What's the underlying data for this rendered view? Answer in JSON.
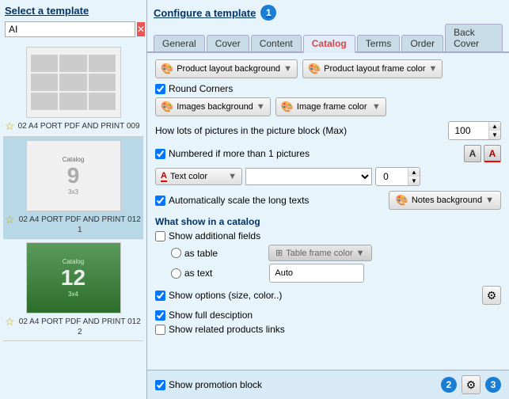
{
  "left_panel": {
    "title": "Select a template",
    "search_placeholder": "AI",
    "templates": [
      {
        "id": "template-1",
        "label": "02 A4 PORT PDF AND PRINT 009",
        "type": "grid",
        "active": false
      },
      {
        "id": "template-2",
        "label": "02 A4 PORT PDF AND PRINT 012 1",
        "type": "catalog",
        "number": "9",
        "sub": "3x3",
        "active": true,
        "green": false
      },
      {
        "id": "template-3",
        "label": "02 A4 PORT PDF AND PRINT 012 2",
        "type": "catalog",
        "number": "12",
        "sub": "3x4",
        "active": false,
        "green": true
      }
    ]
  },
  "right_panel": {
    "title": "Configure a template",
    "badge1": "1",
    "tabs": [
      {
        "label": "General",
        "active": false
      },
      {
        "label": "Cover",
        "active": false
      },
      {
        "label": "Content",
        "active": false
      },
      {
        "label": "Catalog",
        "active": true
      },
      {
        "label": "Terms",
        "active": false
      },
      {
        "label": "Order",
        "active": false
      },
      {
        "label": "Back Cover",
        "active": false
      }
    ],
    "product_layout_background": "Product layout background",
    "product_layout_frame_color": "Product layout frame color",
    "round_corners_label": "Round Corners",
    "round_corners_checked": true,
    "images_background": "Images background",
    "image_frame_color": "Image frame color",
    "how_many_pictures_label": "How lots of pictures in the picture block (Max)",
    "max_pictures_value": "100",
    "numbered_label": "Numbered if more than 1 pictures",
    "numbered_checked": true,
    "text_color_label": "Text color",
    "text_color_value": "0",
    "auto_scale_label": "Automatically scale the long texts",
    "auto_scale_checked": true,
    "notes_background_label": "Notes background",
    "what_show_title": "What show in a catalog",
    "show_additional_label": "Show additional fields",
    "show_additional_checked": false,
    "as_table_label": "as table",
    "as_text_label": "as text",
    "table_frame_color": "Table frame color",
    "auto_label": "Auto",
    "show_options_label": "Show options (size, color..)",
    "show_options_checked": true,
    "show_full_desc_label": "Show full desciption",
    "show_full_desc_checked": true,
    "show_related_label": "Show related products links",
    "show_related_checked": false,
    "show_promotion_label": "Show promotion block",
    "show_promotion_checked": true,
    "badge2": "2",
    "badge3": "3"
  }
}
